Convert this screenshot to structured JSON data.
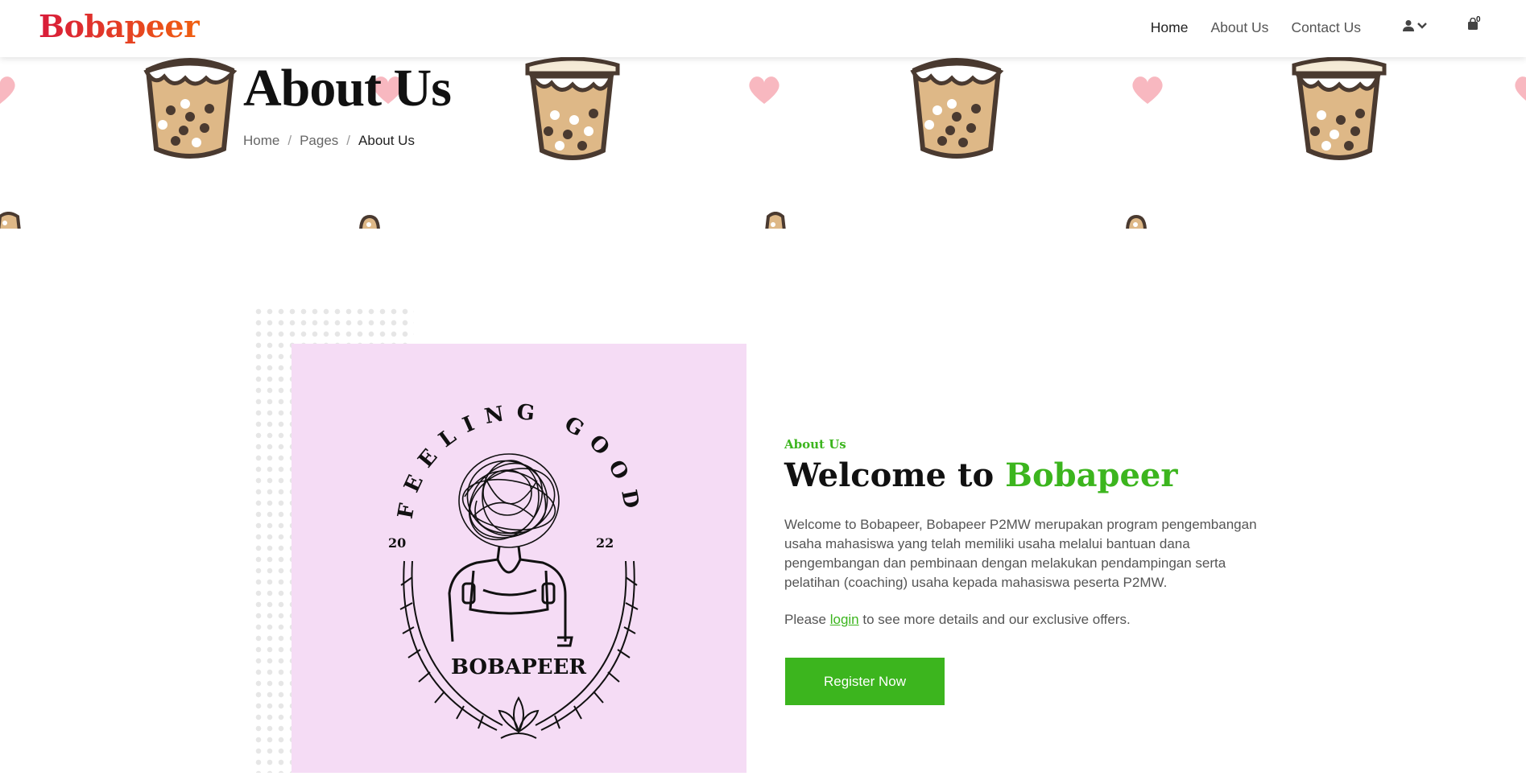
{
  "nav": {
    "brand": "Bobapeer",
    "links": [
      "Home",
      "About Us",
      "Contact Us"
    ],
    "cart_count": "0"
  },
  "hero": {
    "title": "About Us",
    "breadcrumb": [
      "Home",
      "Pages",
      "About Us"
    ]
  },
  "about": {
    "tag": "About Us",
    "heading_prefix": "Welcome to",
    "heading_brand": "Bobapeer",
    "description": "Welcome to Bobapeer, Bobapeer P2MW merupakan program pengembangan usaha mahasiswa yang telah memiliki usaha melalui bantuan dana pengembangan dan pembinaan dengan melakukan pendampingan serta pelatihan (coaching) usaha kepada mahasiswa peserta P2MW.",
    "login_prefix": "Please",
    "login_link": "login",
    "login_suffix": "to see more details and our exclusive offers.",
    "register_label": "Register Now"
  },
  "logo": {
    "arc_text": "FEELING GOOD",
    "year_left": "20",
    "year_right": "22",
    "name": "BOBAPEER"
  },
  "colors": {
    "accent": "#3cb51e",
    "brand_start": "#d81b3a",
    "brand_end": "#f06010",
    "image_bg": "#f5dcf5"
  }
}
